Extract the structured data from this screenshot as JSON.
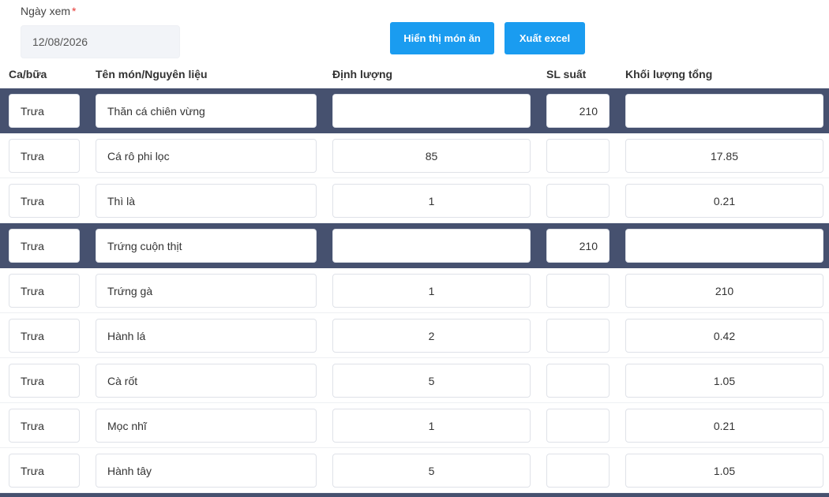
{
  "filter": {
    "date_label": "Ngày xem",
    "required_mark": "*",
    "date_value": "12/08/2026"
  },
  "actions": {
    "show_dishes": "Hiển thị món ăn",
    "export_excel": "Xuất excel"
  },
  "colors": {
    "accent": "#1a9cf0",
    "dish_row_bg": "#46516f"
  },
  "table": {
    "headers": {
      "meal": "Ca/bữa",
      "name": "Tên món/Nguyên liệu",
      "quantity": "Định lượng",
      "servings": "SL suất",
      "total": "Khối lượng tổng"
    },
    "rows": [
      {
        "type": "dish",
        "meal": "Trưa",
        "name": "Thăn cá chiên vừng",
        "quantity": "",
        "servings": "210",
        "total": ""
      },
      {
        "type": "ingredient",
        "meal": "Trưa",
        "name": "Cá rô phi lọc",
        "quantity": "85",
        "servings": "",
        "total": "17.85"
      },
      {
        "type": "ingredient",
        "meal": "Trưa",
        "name": "Thì là",
        "quantity": "1",
        "servings": "",
        "total": "0.21"
      },
      {
        "type": "dish",
        "meal": "Trưa",
        "name": "Trứng cuộn thịt",
        "quantity": "",
        "servings": "210",
        "total": ""
      },
      {
        "type": "ingredient",
        "meal": "Trưa",
        "name": "Trứng gà",
        "quantity": "1",
        "servings": "",
        "total": "210"
      },
      {
        "type": "ingredient",
        "meal": "Trưa",
        "name": "Hành lá",
        "quantity": "2",
        "servings": "",
        "total": "0.42"
      },
      {
        "type": "ingredient",
        "meal": "Trưa",
        "name": "Cà rốt",
        "quantity": "5",
        "servings": "",
        "total": "1.05"
      },
      {
        "type": "ingredient",
        "meal": "Trưa",
        "name": "Mọc nhĩ",
        "quantity": "1",
        "servings": "",
        "total": "0.21"
      },
      {
        "type": "ingredient",
        "meal": "Trưa",
        "name": "Hành tây",
        "quantity": "5",
        "servings": "",
        "total": "1.05"
      }
    ]
  }
}
